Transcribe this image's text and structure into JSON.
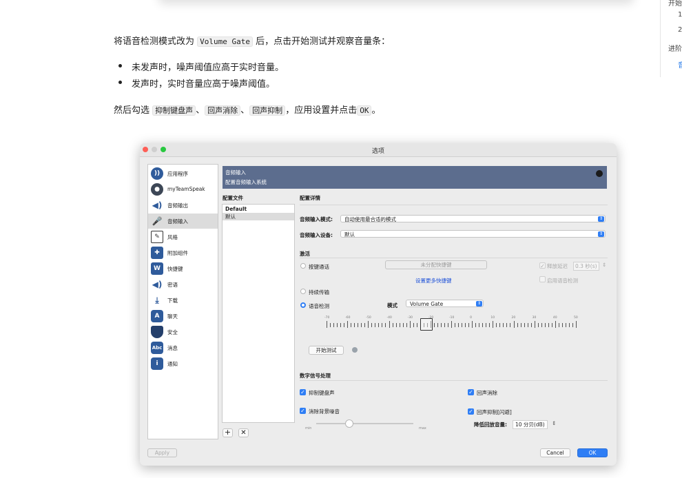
{
  "doc": {
    "p1_a": "将语音检测模式改为",
    "p1_code": "Volume Gate",
    "p1_b": "后，点击开始测试并观察音量条：",
    "bullets": [
      "未发声时，噪声阈值应高于实时音量。",
      "发声时，实时音量应高于噪声阈值。"
    ],
    "p2_a": "然后勾选",
    "p2_code1": "抑制键盘声",
    "p2_sep1": "、",
    "p2_code2": "回声消除",
    "p2_sep2": "、",
    "p2_code3": "回声抑制",
    "p2_b": "，应用设置并点击",
    "p2_code4": "OK",
    "p2_c": "。"
  },
  "toc": [
    "开始",
    "1",
    "2",
    "进阶",
    "音"
  ],
  "window": {
    "title": "选项",
    "sidebar": [
      {
        "label": "应用程序",
        "icon": "app-icon"
      },
      {
        "label": "myTeamSpeak",
        "icon": "user-icon"
      },
      {
        "label": "音频输出",
        "icon": "speaker-icon"
      },
      {
        "label": "音频输入",
        "icon": "microphone-icon"
      },
      {
        "label": "风格",
        "icon": "design-icon"
      },
      {
        "label": "附加组件",
        "icon": "puzzle-icon"
      },
      {
        "label": "快捷键",
        "icon": "hotkey-icon"
      },
      {
        "label": "密语",
        "icon": "whisper-icon"
      },
      {
        "label": "下载",
        "icon": "download-icon"
      },
      {
        "label": "聊天",
        "icon": "chat-icon"
      },
      {
        "label": "安全",
        "icon": "shield-icon"
      },
      {
        "label": "消息",
        "icon": "abc-icon"
      },
      {
        "label": "通知",
        "icon": "info-icon"
      }
    ],
    "banner_title": "音频输入",
    "banner_subtitle": "配置音频输入系统",
    "profiles_header": "配置文件",
    "profiles": [
      "Default",
      "默认"
    ],
    "details_header": "配置详情",
    "input_mode_label": "音频输入模式:",
    "input_mode_value": "自动使用最合适的模式",
    "input_device_label": "音频输入设备:",
    "input_device_value": "默认",
    "activation_header": "激活",
    "ptt_label": "按键通话",
    "hotkey_button": "未分配快捷键",
    "more_hotkeys": "设置更多快捷键",
    "release_delay_label": "释放延迟",
    "release_delay_value": "0.3 秒(s)",
    "voice_detect_ptt": "启用语音检测",
    "continuous_label": "持续传输",
    "voice_activation_label": "语音检测",
    "mode_label": "模式",
    "mode_value": "Volume Gate",
    "meter_ticks": [
      "-70",
      "-60",
      "-50",
      "-40",
      "-30",
      "-20",
      "-10",
      "0",
      "10",
      "20",
      "30",
      "40",
      "50"
    ],
    "start_test": "开始测试",
    "dsp_header": "数字信号处理",
    "typing_suppression": "抑制键盘声",
    "echo_cancel": "回声消除",
    "noise_removal": "消除背景噪音",
    "echo_reduction": "回声抑制[闪避]",
    "reduce_playback_label": "降低回放音量:",
    "reduce_playback_value": "10 分贝(dB)",
    "slider_min": "min",
    "slider_max": "max",
    "apply": "Apply",
    "cancel": "Cancel",
    "ok": "OK",
    "colors": {
      "accent": "#2f7ef5",
      "banner": "#5c6d8e"
    }
  }
}
